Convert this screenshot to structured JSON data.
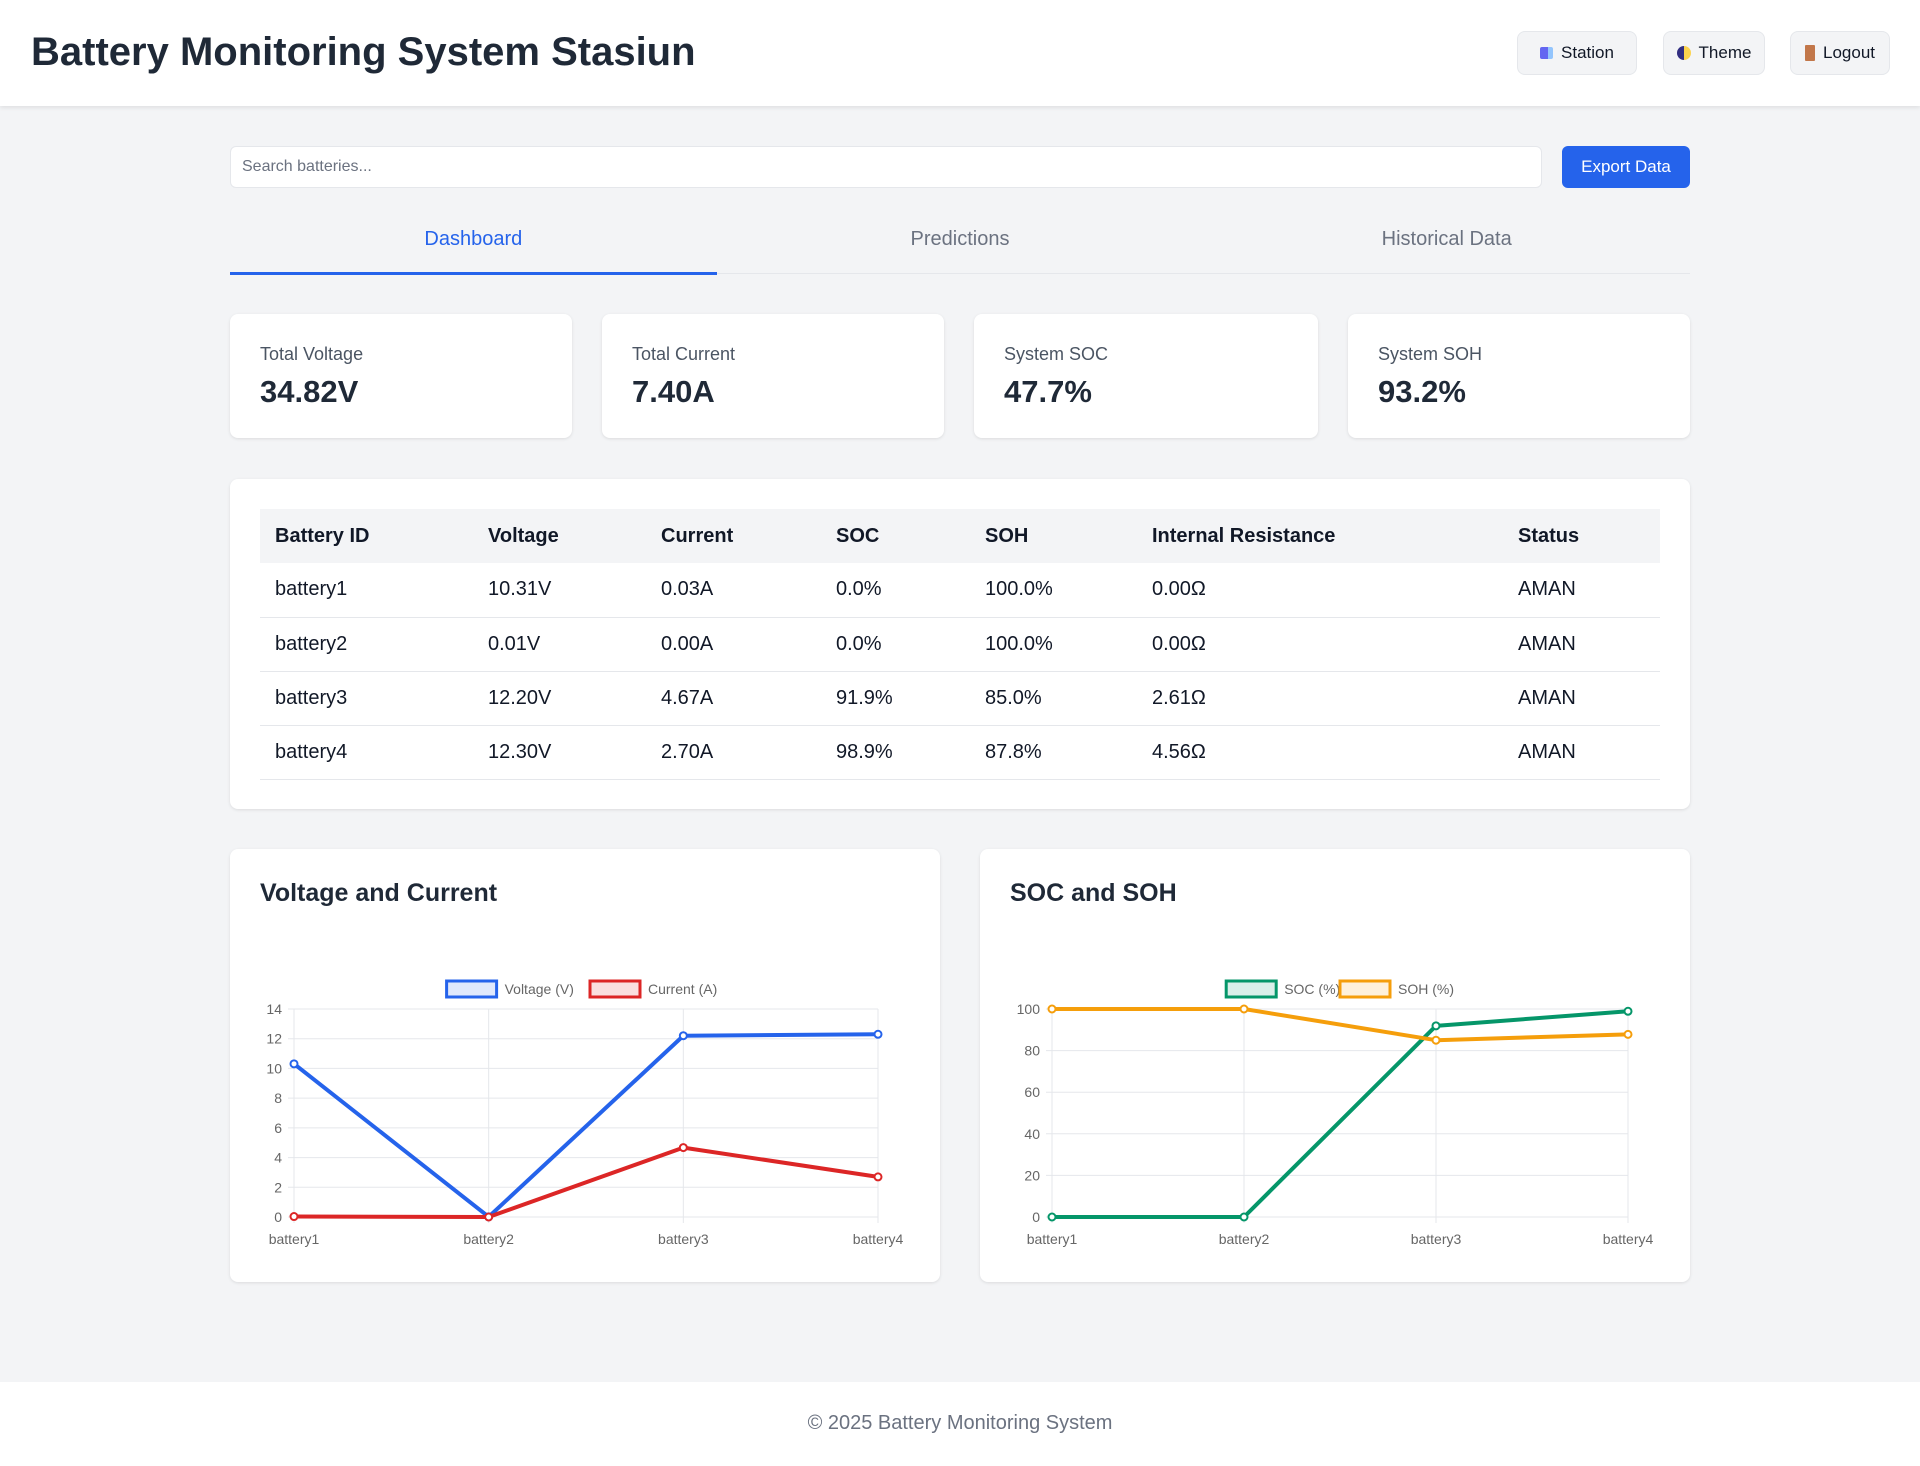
{
  "header": {
    "title": "Battery Monitoring System Stasiun",
    "buttons": {
      "station": "Station",
      "theme": "Theme",
      "logout": "Logout"
    }
  },
  "search": {
    "placeholder": "Search batteries...",
    "value": ""
  },
  "export_label": "Export Data",
  "tabs": [
    "Dashboard",
    "Predictions",
    "Historical Data"
  ],
  "active_tab": "Dashboard",
  "stats": [
    {
      "label": "Total Voltage",
      "value": "34.82V"
    },
    {
      "label": "Total Current",
      "value": "7.40A"
    },
    {
      "label": "System SOC",
      "value": "47.7%"
    },
    {
      "label": "System SOH",
      "value": "93.2%"
    }
  ],
  "table": {
    "headers": [
      "Battery ID",
      "Voltage",
      "Current",
      "SOC",
      "SOH",
      "Internal Resistance",
      "Status"
    ],
    "rows": [
      [
        "battery1",
        "10.31V",
        "0.03A",
        "0.0%",
        "100.0%",
        "0.00Ω",
        "AMAN"
      ],
      [
        "battery2",
        "0.01V",
        "0.00A",
        "0.0%",
        "100.0%",
        "0.00Ω",
        "AMAN"
      ],
      [
        "battery3",
        "12.20V",
        "4.67A",
        "91.9%",
        "85.0%",
        "2.61Ω",
        "AMAN"
      ],
      [
        "battery4",
        "12.30V",
        "2.70A",
        "98.9%",
        "87.8%",
        "4.56Ω",
        "AMAN"
      ]
    ]
  },
  "chart_data": [
    {
      "type": "line",
      "title": "Voltage and Current",
      "categories": [
        "battery1",
        "battery2",
        "battery3",
        "battery4"
      ],
      "series": [
        {
          "name": "Voltage (V)",
          "values": [
            10.31,
            0.01,
            12.2,
            12.3
          ],
          "color": "#2563eb"
        },
        {
          "name": "Current (A)",
          "values": [
            0.03,
            0.0,
            4.67,
            2.7
          ],
          "color": "#dc2626"
        }
      ],
      "ylim": [
        0,
        14
      ],
      "yticks": [
        0,
        2,
        4,
        6,
        8,
        10,
        12,
        14
      ],
      "legend": "top",
      "grid": true
    },
    {
      "type": "line",
      "title": "SOC and SOH",
      "categories": [
        "battery1",
        "battery2",
        "battery3",
        "battery4"
      ],
      "series": [
        {
          "name": "SOC (%)",
          "values": [
            0.0,
            0.0,
            91.9,
            98.9
          ],
          "color": "#059669"
        },
        {
          "name": "SOH (%)",
          "values": [
            100.0,
            100.0,
            85.0,
            87.8
          ],
          "color": "#f59e0b"
        }
      ],
      "ylim": [
        0,
        100
      ],
      "yticks": [
        0,
        20,
        40,
        60,
        80,
        100
      ],
      "legend": "top",
      "grid": true
    }
  ],
  "footer": "© 2025 Battery Monitoring System",
  "colors": {
    "accent": "#2563eb",
    "text": "#1f2937",
    "muted": "#6b7280",
    "background": "#f3f4f6"
  }
}
